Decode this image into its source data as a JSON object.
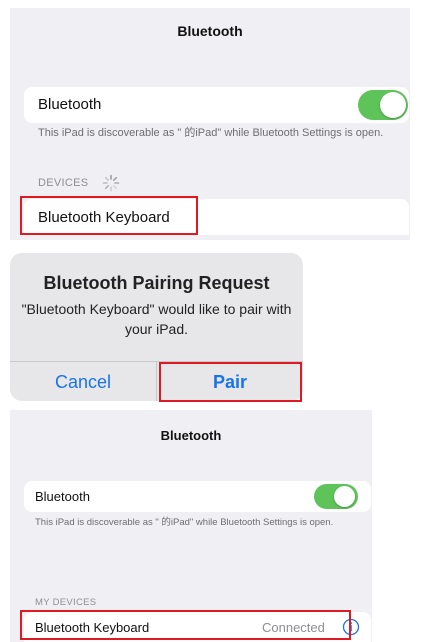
{
  "screen1": {
    "title": "Bluetooth",
    "bluetooth_label": "Bluetooth",
    "bluetooth_on": true,
    "discoverable_text": "This iPad is discoverable as \"   的iPad\" while Bluetooth Settings is open.",
    "devices_header": "DEVICES",
    "device_name": "Bluetooth Keyboard"
  },
  "alert": {
    "title": "Bluetooth Pairing Request",
    "message": "\"Bluetooth Keyboard\" would like to pair with your iPad.",
    "cancel_label": "Cancel",
    "pair_label": "Pair"
  },
  "screen3": {
    "title": "Bluetooth",
    "bluetooth_label": "Bluetooth",
    "bluetooth_on": true,
    "discoverable_text": "This iPad is discoverable as \"   的iPad\" while Bluetooth Settings is open.",
    "devices_header": "MY DEVICES",
    "device_name": "Bluetooth Keyboard",
    "device_status": "Connected"
  },
  "colors": {
    "toggle_on": "#5ec45a",
    "highlight": "#e01a22",
    "accent": "#1a73e8",
    "background": "#efeff4"
  }
}
